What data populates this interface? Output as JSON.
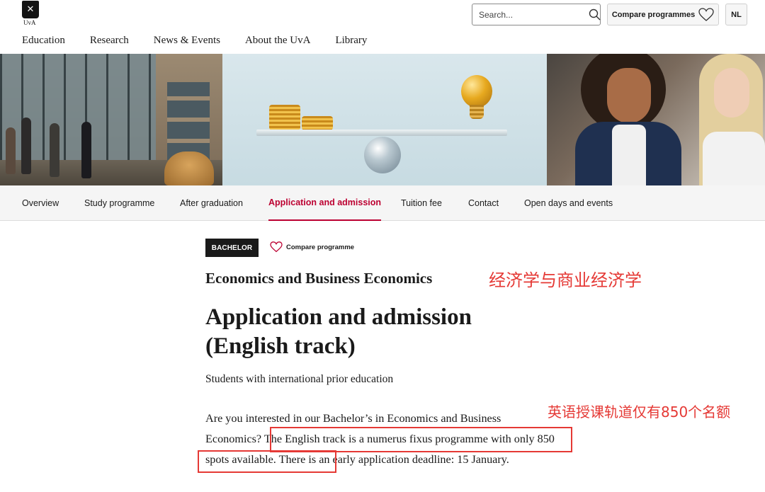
{
  "header": {
    "logo_text": "UvA",
    "search_placeholder": "Search...",
    "compare_label": "Compare programmes",
    "language_label": "NL"
  },
  "main_nav": [
    "Education",
    "Research",
    "News & Events",
    "About the UvA",
    "Library"
  ],
  "sub_nav": {
    "tabs": [
      "Overview",
      "Study programme",
      "After graduation",
      "Application and admission",
      "Tuition fee",
      "Contact",
      "Open days and events"
    ],
    "active": "Application and admission"
  },
  "content": {
    "badge": "BACHELOR",
    "compare_link": "Compare programme",
    "programme_name": "Economics and Business Economics",
    "page_title": "Application and admission (English track)",
    "subtitle": "Students with international prior education",
    "body_part1": "Are you interested in our Bachelor’s in Economics and Business Economics?",
    "body_part2": "The English track is a numerus fixus programme with only 850 spots available.",
    "body_part3": "There is an early application deadline: 15 January."
  },
  "annotations": {
    "programme_translation": "经济学与商业经济学",
    "spots_note": "英语授课轨道仅有850个名额"
  },
  "colors": {
    "accent": "#bc0031",
    "annotation": "#e53935"
  }
}
